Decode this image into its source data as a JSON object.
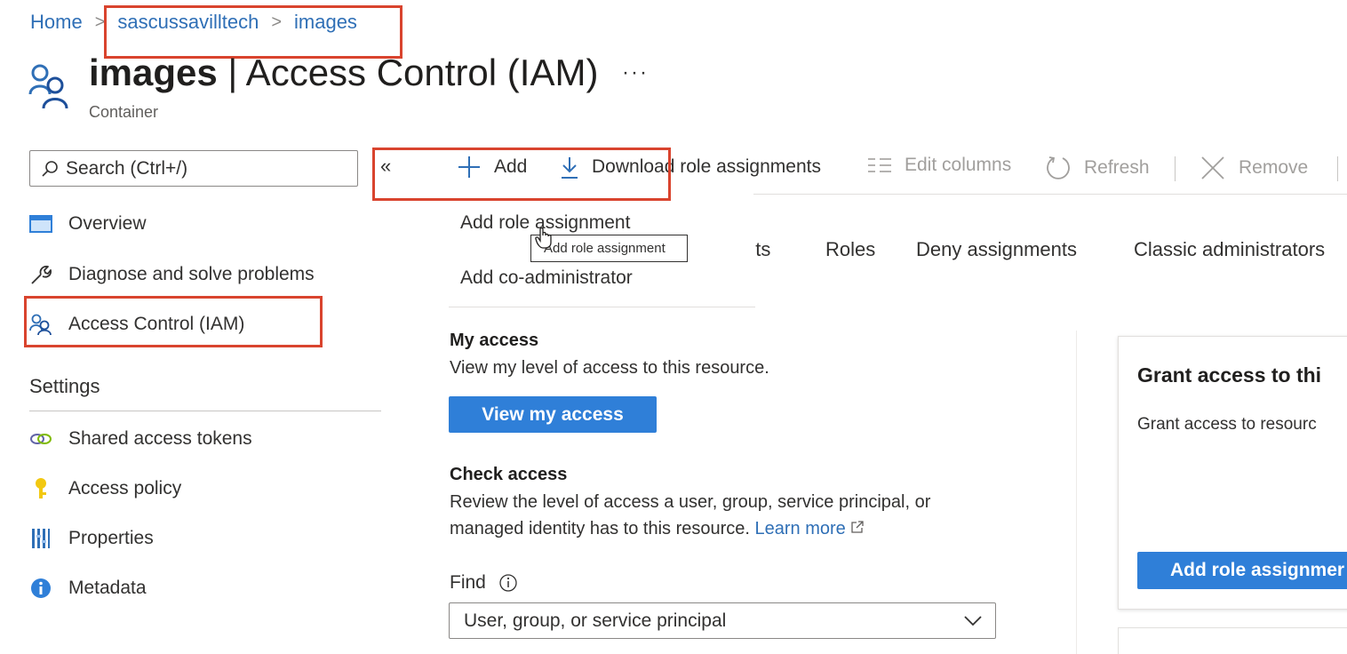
{
  "breadcrumb": {
    "home": "Home",
    "account": "sascussavilltech",
    "container": "images",
    "separator": ">"
  },
  "header": {
    "resource_name": "images",
    "title_suffix": " | Access Control (IAM)",
    "more": "···",
    "subtitle": "Container"
  },
  "search": {
    "placeholder": "Search (Ctrl+/)",
    "collapse": "«"
  },
  "nav": {
    "overview": "Overview",
    "diagnose": "Diagnose and solve problems",
    "iam": "Access Control (IAM)",
    "settings_title": "Settings",
    "shared_access_tokens": "Shared access tokens",
    "access_policy": "Access policy",
    "properties": "Properties",
    "metadata": "Metadata"
  },
  "toolbar": {
    "add": "Add",
    "download": "Download role assignments",
    "edit_columns": "Edit columns",
    "refresh": "Refresh",
    "remove": "Remove"
  },
  "add_menu": {
    "items": [
      "Add role assignment",
      "Add co-administrator"
    ],
    "tooltip": "Add role assignment"
  },
  "tabs": {
    "role_assignments_fragment": "nts",
    "roles": "Roles",
    "deny": "Deny assignments",
    "classic": "Classic administrators"
  },
  "my_access": {
    "title": "My access",
    "description": "View my level of access to this resource.",
    "button": "View my access"
  },
  "check_access": {
    "title": "Check access",
    "description_line1": "Review the level of access a user, group, service principal, or",
    "description_line2": "managed identity has to this resource.",
    "learn_more": "Learn more",
    "find_label": "Find",
    "find_value": "User, group, or service principal"
  },
  "grant_card": {
    "title": "Grant access to thi",
    "text": "Grant access to resourc",
    "button": "Add role assignmer"
  },
  "colors": {
    "accent": "#2f7fd8",
    "link": "#2f6fb6",
    "highlight": "#d9442e"
  }
}
